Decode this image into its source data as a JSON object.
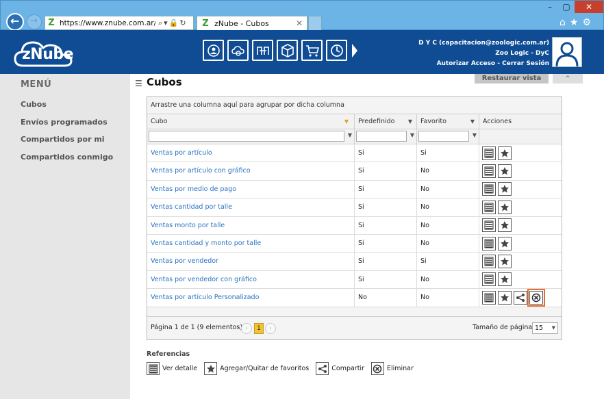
{
  "browser": {
    "url": "https://www.znube.com.ar/OLAP,",
    "tab_title": "zNube - Cubos",
    "tab_icon": "Z"
  },
  "header": {
    "logo_text": "zNube",
    "user_line1": "D Y C (capacitacion@zoologic.com.ar)",
    "user_line2": "Zoo Logic - DyC",
    "authorize_label": "Autorizar Acceso",
    "separator": "-",
    "logout_label": "Cerrar Sesión",
    "nav_icons": [
      "users-cycle-icon",
      "cloud-gear-icon",
      "transfer-icon",
      "cube-icon",
      "cart-icon",
      "clock-icon"
    ]
  },
  "sidebar": {
    "title": "MENÚ",
    "items": [
      {
        "label": "Cubos"
      },
      {
        "label": "Envíos programados"
      },
      {
        "label": "Compartidos por mi"
      },
      {
        "label": "Compartidos conmigo"
      }
    ]
  },
  "main": {
    "title": "Cubos",
    "restore_label": "Restaurar vista",
    "collapse_label": "^"
  },
  "grid": {
    "group_hint": "Arrastre una columna aquí para agrupar por dicha columna",
    "columns": [
      "Cubo",
      "Predefinido",
      "Favorito",
      "Acciones"
    ],
    "rows": [
      {
        "cubo": "Ventas por artículo",
        "predefinido": "Si",
        "favorito": "Si",
        "extra": false
      },
      {
        "cubo": "Ventas por artículo con gráfico",
        "predefinido": "Si",
        "favorito": "No",
        "extra": false
      },
      {
        "cubo": "Ventas por medio de pago",
        "predefinido": "Si",
        "favorito": "No",
        "extra": false
      },
      {
        "cubo": "Ventas cantidad por talle",
        "predefinido": "Si",
        "favorito": "No",
        "extra": false
      },
      {
        "cubo": "Ventas monto por talle",
        "predefinido": "Si",
        "favorito": "No",
        "extra": false
      },
      {
        "cubo": "Ventas cantidad y monto por talle",
        "predefinido": "Si",
        "favorito": "No",
        "extra": false
      },
      {
        "cubo": "Ventas por vendedor",
        "predefinido": "Si",
        "favorito": "Si",
        "extra": false
      },
      {
        "cubo": "Ventas por vendedor con gráfico",
        "predefinido": "Si",
        "favorito": "No",
        "extra": false
      },
      {
        "cubo": "Ventas por artículo Personalizado",
        "predefinido": "No",
        "favorito": "No",
        "extra": true
      }
    ],
    "pager": {
      "summary": "Página 1 de 1 (9 elementos)",
      "prev": "‹",
      "current_page": "1",
      "next": "›",
      "page_size_label": "Tamaño de página:",
      "page_size": "15"
    }
  },
  "references": {
    "title": "Referencias",
    "items": [
      {
        "icon": "list-detail-icon",
        "label": "Ver detalle"
      },
      {
        "icon": "star-icon",
        "label": "Agregar/Quitar de favoritos"
      },
      {
        "icon": "share-icon",
        "label": "Compartir"
      },
      {
        "icon": "delete-icon",
        "label": "Eliminar"
      }
    ]
  },
  "colors": {
    "header_bg": "#0f4c94",
    "link": "#2a72c2",
    "highlight": "#e86d2a",
    "pager_current": "#f4c430"
  }
}
